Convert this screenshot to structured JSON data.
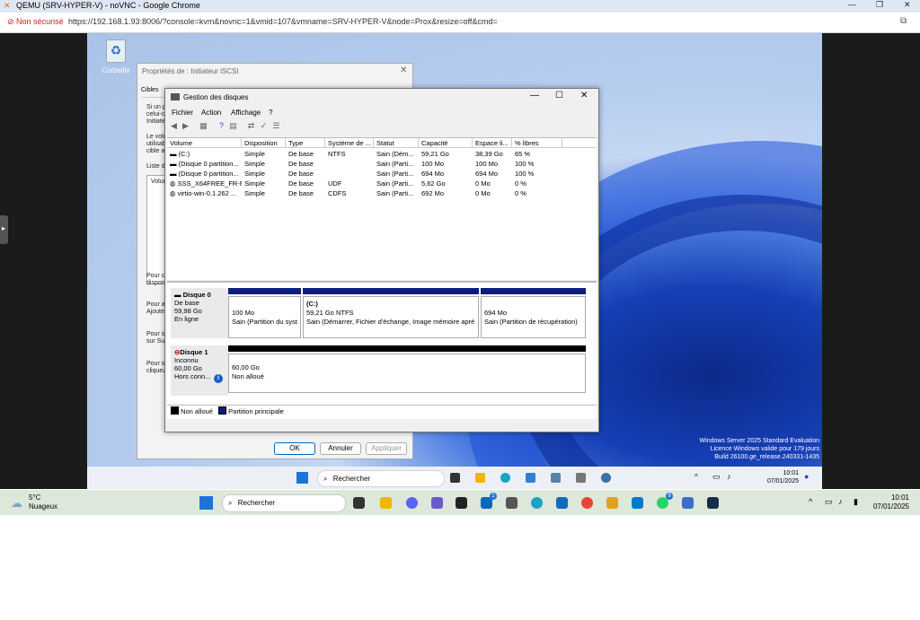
{
  "browser": {
    "title": "QEMU (SRV-HYPER-V) - noVNC - Google Chrome",
    "not_secure": "Non sécurisé",
    "url": "https://192.168.1.93:8006/?console=kvm&novnc=1&vmid=107&vmname=SRV-HYPER-V&node=Prox&resize=off&cmd=",
    "minimize": "—",
    "restore": "❐",
    "close": "✕"
  },
  "desktop": {
    "recycle_bin": "Corbeille"
  },
  "iscsi_dialog": {
    "title": "Propriétés de : Initiateur iSCSI",
    "close": "✕",
    "tab_targets": "Cibles",
    "texts": [
      "Si un p",
      "celui-ci",
      "Initiate",
      "Le volu",
      "utilisab",
      "cible ai",
      "Liste d",
      "Volun",
      "Pour c",
      "dispon",
      "Pour a",
      "Ajoute",
      "Pour s",
      "sur Sup",
      "Pour s",
      "cliquez"
    ],
    "ok": "OK",
    "cancel": "Annuler",
    "apply": "Appliquer"
  },
  "disk_mgmt": {
    "title": "Gestion des disques",
    "menu": [
      "Fichier",
      "Action",
      "Affichage",
      "?"
    ],
    "columns": [
      "Volume",
      "Disposition",
      "Type",
      "Système de ...",
      "Statut",
      "Capacité",
      "Espace li...",
      "% libres"
    ],
    "rows": [
      [
        "(C:)",
        "Simple",
        "De base",
        "NTFS",
        "Sain (Dém...",
        "59,21 Go",
        "38,39 Go",
        "65 %"
      ],
      [
        "(Disque 0 partition...",
        "Simple",
        "De base",
        "",
        "Sain (Parti...",
        "100 Mo",
        "100 Mo",
        "100 %"
      ],
      [
        "(Disque 0 partition...",
        "Simple",
        "De base",
        "",
        "Sain (Parti...",
        "694 Mo",
        "694 Mo",
        "100 %"
      ],
      [
        "SSS_X64FREE_FR-F...",
        "Simple",
        "De base",
        "UDF",
        "Sain (Parti...",
        "5,62 Go",
        "0 Mo",
        "0 %"
      ],
      [
        "virtio-win-0.1.262 ...",
        "Simple",
        "De base",
        "CDFS",
        "Sain (Parti...",
        "692 Mo",
        "0 Mo",
        "0 %"
      ]
    ],
    "disk0": {
      "name": "Disque 0",
      "type": "De base",
      "size": "59,98 Go",
      "state": "En ligne",
      "p1_size": "100 Mo",
      "p1_status": "Sain (Partition du syst",
      "p2_name": "(C:)",
      "p2_size": "59,21 Go NTFS",
      "p2_status": "Sain (Démarrer, Fichier d'échange, Image mémoire apré",
      "p3_size": "694 Mo",
      "p3_status": "Sain (Partition de récupération)"
    },
    "disk1": {
      "name": "Disque 1",
      "type": "Inconnu",
      "size": "60,00 Go",
      "state": "Hors conn...",
      "p1_size": "60,00 Go",
      "p1_status": "Non alloué"
    },
    "legend": [
      "Non alloué",
      "Partition principale"
    ]
  },
  "remote_watermark": [
    "Windows Server 2025 Standard Evaluation",
    "Licence Windows valide pour 179 jours",
    "Build 26100.ge_release.240331-1435"
  ],
  "remote_taskbar": {
    "search": "Rechercher",
    "time": "10:01",
    "date": "07/01/2025"
  },
  "host_taskbar": {
    "weather_temp": "5°C",
    "weather_desc": "Nuageux",
    "search": "Rechercher",
    "badge_linkedin": "1",
    "badge_whatsapp": "9",
    "time": "10:01",
    "date": "07/01/2025"
  },
  "colors": {
    "primary_partition": "#0b1e7a",
    "unallocated": "#000000",
    "not_secure": "#c5221f"
  }
}
